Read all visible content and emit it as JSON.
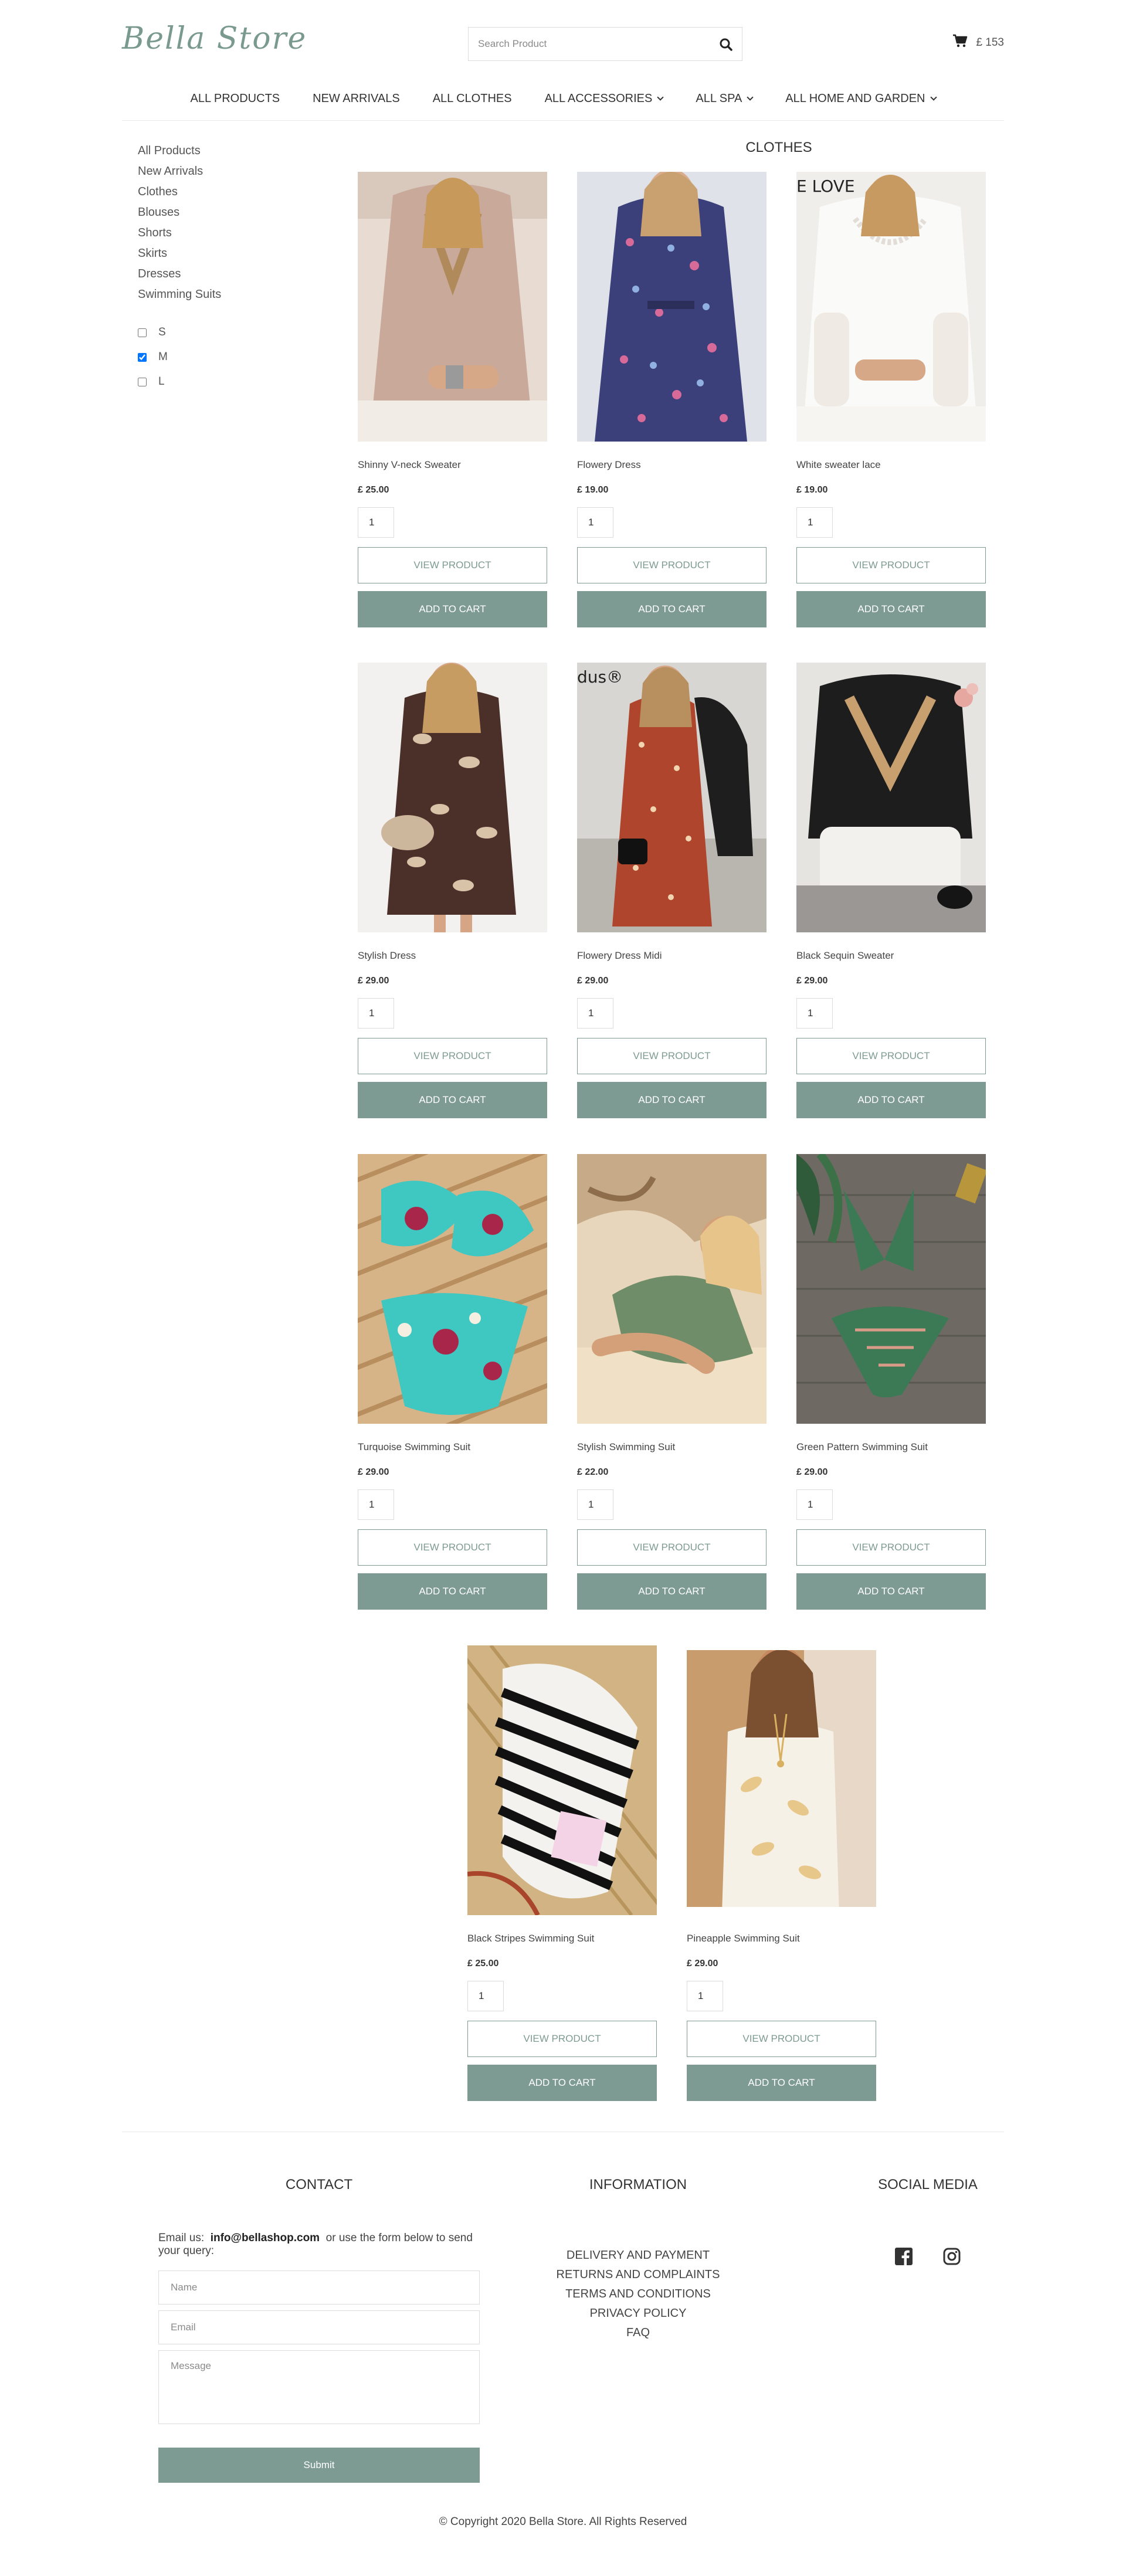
{
  "header": {
    "logo": "Bella Store",
    "search_placeholder": "Search Product",
    "cart_total": "£ 153"
  },
  "nav": [
    {
      "label": "ALL PRODUCTS",
      "dropdown": false
    },
    {
      "label": "NEW ARRIVALS",
      "dropdown": false
    },
    {
      "label": "ALL CLOTHES",
      "dropdown": false
    },
    {
      "label": "ALL ACCESSORIES",
      "dropdown": true
    },
    {
      "label": "All SPA",
      "dropdown": true
    },
    {
      "label": "All HOME AND GARDEN",
      "dropdown": true
    }
  ],
  "sidebar": {
    "categories": [
      "All Products",
      "New Arrivals",
      "Clothes",
      "Blouses",
      "Shorts",
      "Skirts",
      "Dresses",
      "Swimming Suits"
    ],
    "sizes": [
      {
        "label": "S",
        "checked": false
      },
      {
        "label": "M",
        "checked": true
      },
      {
        "label": "L",
        "checked": false
      }
    ]
  },
  "main": {
    "title": "CLOTHES",
    "view_label": "VIEW PRODUCT",
    "add_label": "ADD TO CART",
    "products": [
      {
        "name": "Shinny V-neck Sweater",
        "price": "£ 25.00",
        "qty": "1",
        "image": "beige-sequin-sweater"
      },
      {
        "name": "Flowery Dress",
        "price": "£ 19.00",
        "qty": "1",
        "image": "navy-floral-dress"
      },
      {
        "name": "White sweater lace",
        "price": "£ 19.00",
        "qty": "1",
        "image": "white-lace-sweater",
        "image_text": "E LOVE"
      },
      {
        "name": "Stylish Dress",
        "price": "£ 29.00",
        "qty": "1",
        "image": "paisley-dress"
      },
      {
        "name": "Flowery Dress Midi",
        "price": "£ 29.00",
        "qty": "1",
        "image": "red-floral-midi-dress",
        "image_text": "dus®"
      },
      {
        "name": "Black Sequin Sweater",
        "price": "£ 29.00",
        "qty": "1",
        "image": "black-sequin-sweater"
      },
      {
        "name": "Turquoise Swimming Suit",
        "price": "£ 29.00",
        "qty": "1",
        "image": "turquoise-floral-bikini"
      },
      {
        "name": "Stylish Swimming Suit",
        "price": "£ 22.00",
        "qty": "1",
        "image": "green-swimsuit-beach"
      },
      {
        "name": "Green Pattern Swimming Suit",
        "price": "£ 29.00",
        "qty": "1",
        "image": "green-pattern-bikini"
      },
      {
        "name": "Black Stripes Swimming Suit",
        "price": "£ 25.00",
        "qty": "1",
        "image": "black-stripe-swimsuit"
      },
      {
        "name": "Pineapple Swimming Suit",
        "price": "£ 29.00",
        "qty": "1",
        "image": "pineapple-swimsuit"
      }
    ]
  },
  "footer": {
    "contact": {
      "title": "CONTACT",
      "text_prefix": "Email us:",
      "email": "info@bellashop.com",
      "text_suffix": "or use the form below to send your query:",
      "name_placeholder": "Name",
      "email_placeholder": "Email",
      "message_placeholder": "Message",
      "submit_label": "Submit"
    },
    "information": {
      "title": "INFORMATION",
      "links": [
        "DELIVERY AND PAYMENT",
        "RETURNS AND COMPLAINTS",
        "TERMS AND CONDITIONS",
        "PRIVACY POLICY",
        "FAQ"
      ]
    },
    "social": {
      "title": "SOCIAL MEDIA",
      "icons": [
        "facebook-icon",
        "instagram-icon"
      ]
    },
    "copyright": "© Copyright 2020 Bella Store. All Rights Reserved"
  },
  "colors": {
    "accent": "#7d9b92",
    "logo": "#7a9a90",
    "text": "#333333"
  }
}
